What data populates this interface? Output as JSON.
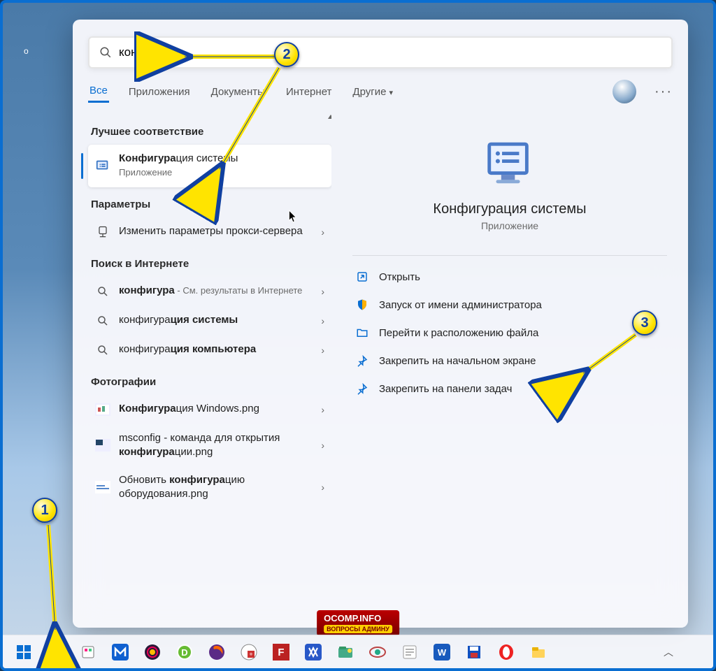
{
  "search": {
    "query": "конфигура"
  },
  "tabs": [
    "Все",
    "Приложения",
    "Документы",
    "Интернет",
    "Другие"
  ],
  "sections": {
    "best": "Лучшее соответствие",
    "params": "Параметры",
    "web": "Поиск в Интернете",
    "photos": "Фотографии"
  },
  "bestMatch": {
    "titlePrefix": "Конфигура",
    "titleRest": "ция системы",
    "sub": "Приложение"
  },
  "paramItem": {
    "text": "Изменить параметры прокси-сервера"
  },
  "webItems": [
    {
      "prefix": "конфигура",
      "suffix": " - См. результаты в Интернете"
    },
    {
      "prefix": "конфигура",
      "suffix": "ция системы"
    },
    {
      "prefix": "конфигура",
      "suffix": "ция компьютера"
    }
  ],
  "photoItems": [
    {
      "bold": "Конфигура",
      "rest": "ция Windows.png"
    },
    {
      "pre": "msconfig - команда для открытия ",
      "bold": "конфигура",
      "rest": "ции.png"
    },
    {
      "pre": "Обновить ",
      "bold": "конфигура",
      "rest": "цию оборудования.png"
    }
  ],
  "preview": {
    "title": "Конфигурация системы",
    "sub": "Приложение",
    "actions": [
      {
        "icon": "open",
        "label": "Открыть"
      },
      {
        "icon": "admin",
        "label": "Запуск от имени администратора"
      },
      {
        "icon": "folder",
        "label": "Перейти к расположению файла"
      },
      {
        "icon": "pin",
        "label": "Закрепить на начальном экране"
      },
      {
        "icon": "pin",
        "label": "Закрепить на панели задач"
      }
    ]
  },
  "watermark": {
    "main": "OCOMP.INFO",
    "sub": "ВОПРОСЫ АДМИНУ"
  },
  "callouts": {
    "1": "1",
    "2": "2",
    "3": "3"
  }
}
